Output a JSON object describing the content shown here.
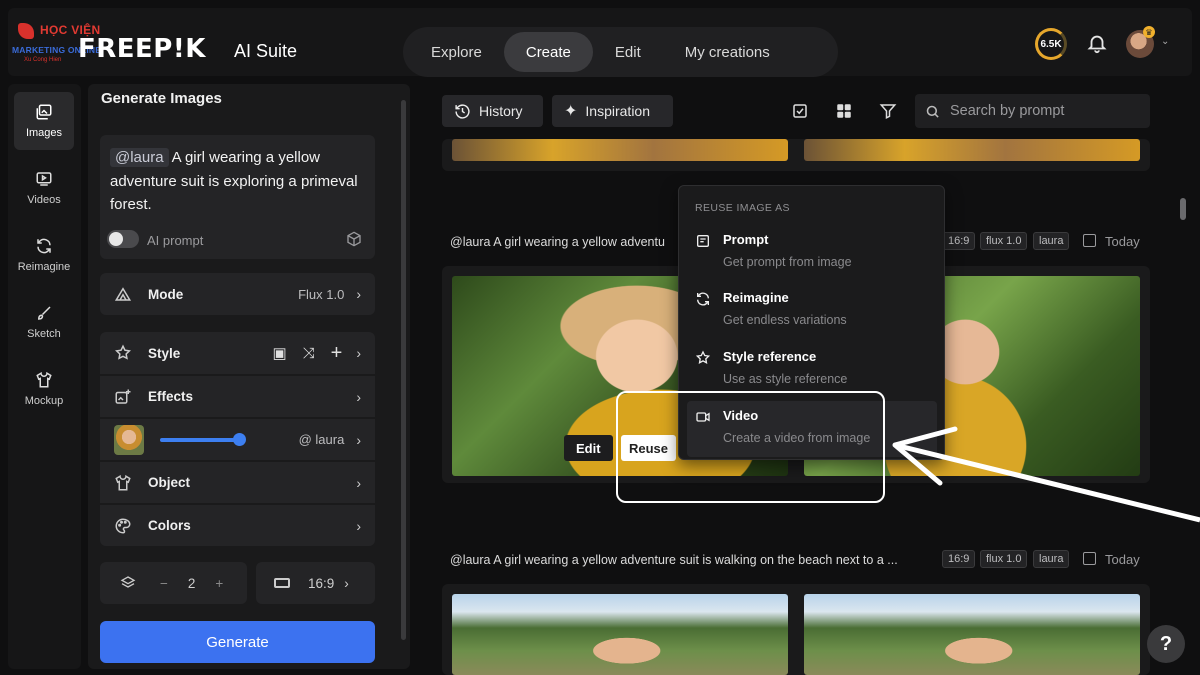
{
  "brand": {
    "watermark_line1": "HỌC VIỆN",
    "watermark_line2": "MARKETING ONLINE",
    "watermark_line3": "Xu Cong Hien",
    "logo": "FREEP!K",
    "suite": "AI Suite"
  },
  "nav": {
    "tabs": [
      "Explore",
      "Create",
      "Edit",
      "My creations"
    ],
    "active": "Create"
  },
  "header": {
    "credits": "6.5K"
  },
  "rail": [
    {
      "label": "Images",
      "icon": "images-icon",
      "active": true
    },
    {
      "label": "Videos",
      "icon": "video-icon"
    },
    {
      "label": "Reimagine",
      "icon": "refresh-icon"
    },
    {
      "label": "Sketch",
      "icon": "brush-icon"
    },
    {
      "label": "Mockup",
      "icon": "shirt-icon"
    }
  ],
  "panel": {
    "title": "Generate Images",
    "prompt_mention": "@laura",
    "prompt_text": "A girl wearing a yellow adventure suit is exploring a primeval forest.",
    "ai_prompt_label": "AI prompt",
    "mode_label": "Mode",
    "mode_value": "Flux 1.0",
    "style_label": "Style",
    "effects_label": "Effects",
    "character_value": "@ laura",
    "object_label": "Object",
    "colors_label": "Colors",
    "count_minus": "−",
    "count": "2",
    "count_plus": "+",
    "aspect": "16:9",
    "generate_label": "Generate"
  },
  "toolbar": {
    "history_label": "History",
    "inspiration_label": "Inspiration",
    "search_placeholder": "Search by prompt"
  },
  "cards": [
    {
      "caption": "@laura A girl wearing a yellow adventu",
      "chips": [
        "16:9",
        "flux 1.0",
        "laura"
      ],
      "date": "Today"
    },
    {
      "caption": "@laura A girl wearing a yellow adventure suit is walking on the beach next to a ...",
      "chips": [
        "16:9",
        "flux 1.0",
        "laura"
      ],
      "date": "Today"
    }
  ],
  "image_actions": {
    "edit": "Edit",
    "reuse": "Reuse"
  },
  "reuse_menu": {
    "header": "REUSE IMAGE AS",
    "items": [
      {
        "title": "Prompt",
        "subtitle": "Get prompt from image",
        "icon": "prompt-icon"
      },
      {
        "title": "Reimagine",
        "subtitle": "Get endless variations",
        "icon": "reimagine-icon"
      },
      {
        "title": "Style reference",
        "subtitle": "Use as style reference",
        "icon": "style-icon"
      },
      {
        "title": "Video",
        "subtitle": "Create a video from image",
        "icon": "video-icon"
      }
    ]
  },
  "help": "?"
}
